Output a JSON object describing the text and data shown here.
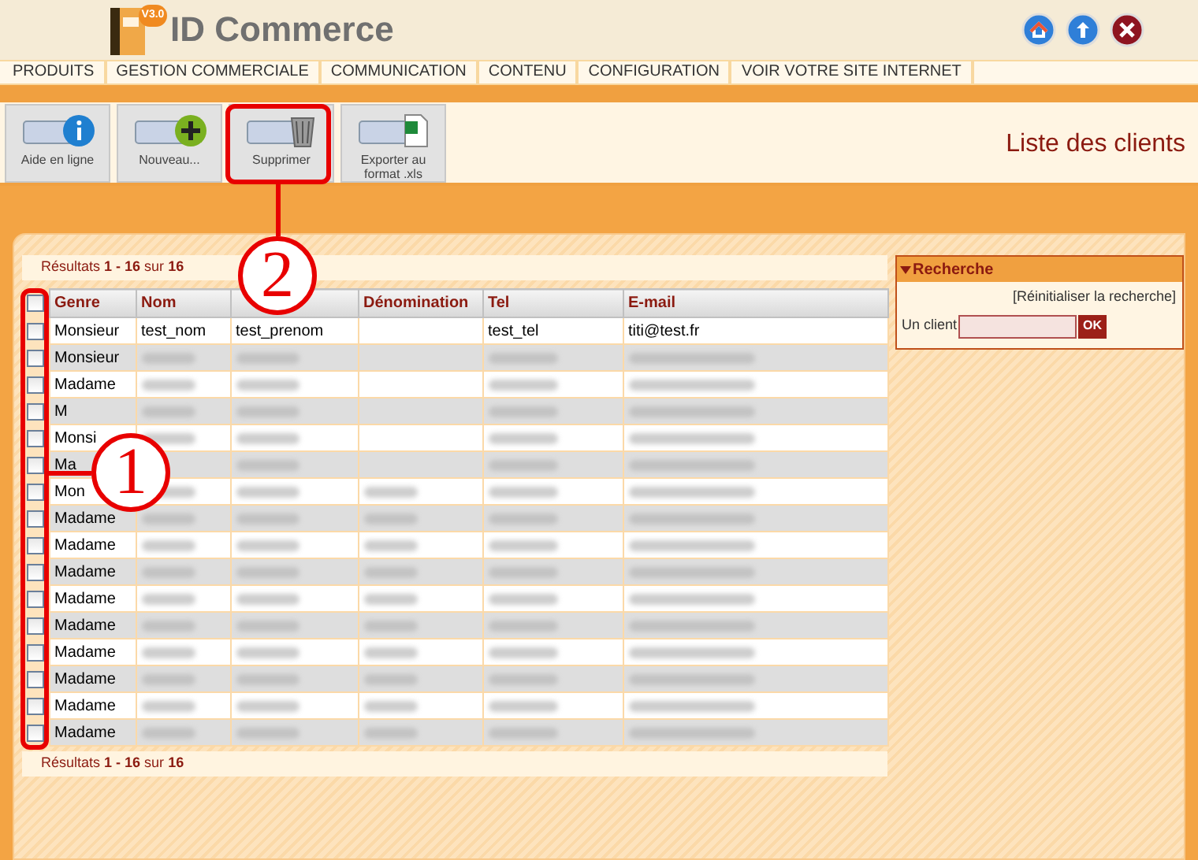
{
  "app": {
    "name": "ID Commerce",
    "version": "V3.0"
  },
  "menu": [
    {
      "label": "PRODUITS"
    },
    {
      "label": "GESTION COMMERCIALE"
    },
    {
      "label": "COMMUNICATION"
    },
    {
      "label": "CONTENU"
    },
    {
      "label": "CONFIGURATION"
    },
    {
      "label": "VOIR VOTRE SITE INTERNET"
    }
  ],
  "toolbar": [
    {
      "label": "Aide en ligne",
      "kind": "info"
    },
    {
      "label": "Nouveau...",
      "kind": "add"
    },
    {
      "label": "Supprimer",
      "kind": "delete"
    },
    {
      "label": "Exporter au format .xls",
      "kind": "excel"
    }
  ],
  "page_title": "Liste des clients",
  "results_top": {
    "prefix": "Résultats",
    "range": "1 - 16",
    "word": "sur",
    "total": "16"
  },
  "table": {
    "select_all": {
      "checked": false
    },
    "columns": [
      "Genre",
      "Nom",
      null,
      "Dénomination",
      "Tel",
      "E-mail"
    ],
    "rows": [
      {
        "checked": false,
        "cells": [
          {
            "kind": "text",
            "text": "Monsieur"
          },
          {
            "kind": "text",
            "text": "test_nom"
          },
          {
            "kind": "text",
            "text": "test_prenom"
          },
          {
            "kind": "empty"
          },
          {
            "kind": "text",
            "text": "test_tel"
          },
          {
            "kind": "text",
            "text": "titi@test.fr"
          }
        ]
      },
      {
        "checked": false,
        "cells": [
          {
            "kind": "text",
            "text": "Monsieur"
          },
          {
            "kind": "blurred"
          },
          {
            "kind": "blurred"
          },
          {
            "kind": "empty"
          },
          {
            "kind": "blurred"
          },
          {
            "kind": "blurred"
          }
        ]
      },
      {
        "checked": false,
        "cells": [
          {
            "kind": "text",
            "text": "Madame"
          },
          {
            "kind": "blurred"
          },
          {
            "kind": "blurred"
          },
          {
            "kind": "empty"
          },
          {
            "kind": "blurred"
          },
          {
            "kind": "blurred"
          }
        ]
      },
      {
        "checked": false,
        "cells": [
          {
            "kind": "text",
            "text": "M"
          },
          {
            "kind": "blurred"
          },
          {
            "kind": "blurred"
          },
          {
            "kind": "empty"
          },
          {
            "kind": "blurred"
          },
          {
            "kind": "blurred"
          }
        ]
      },
      {
        "checked": false,
        "cells": [
          {
            "kind": "text",
            "text": "Monsi"
          },
          {
            "kind": "blurred"
          },
          {
            "kind": "blurred"
          },
          {
            "kind": "empty"
          },
          {
            "kind": "blurred"
          },
          {
            "kind": "blurred"
          }
        ]
      },
      {
        "checked": false,
        "cells": [
          {
            "kind": "text",
            "text": "Ma"
          },
          {
            "kind": "empty"
          },
          {
            "kind": "blurred"
          },
          {
            "kind": "empty"
          },
          {
            "kind": "blurred"
          },
          {
            "kind": "blurred"
          }
        ]
      },
      {
        "checked": false,
        "cells": [
          {
            "kind": "text",
            "text": "Mon"
          },
          {
            "kind": "blurred"
          },
          {
            "kind": "blurred"
          },
          {
            "kind": "blurred"
          },
          {
            "kind": "blurred"
          },
          {
            "kind": "blurred"
          }
        ]
      },
      {
        "checked": false,
        "cells": [
          {
            "kind": "text",
            "text": "Madame"
          },
          {
            "kind": "blurred"
          },
          {
            "kind": "blurred"
          },
          {
            "kind": "blurred"
          },
          {
            "kind": "blurred"
          },
          {
            "kind": "blurred"
          }
        ]
      },
      {
        "checked": false,
        "cells": [
          {
            "kind": "text",
            "text": "Madame"
          },
          {
            "kind": "blurred"
          },
          {
            "kind": "blurred"
          },
          {
            "kind": "blurred"
          },
          {
            "kind": "blurred"
          },
          {
            "kind": "blurred"
          }
        ]
      },
      {
        "checked": false,
        "cells": [
          {
            "kind": "text",
            "text": "Madame"
          },
          {
            "kind": "blurred"
          },
          {
            "kind": "blurred"
          },
          {
            "kind": "blurred"
          },
          {
            "kind": "blurred"
          },
          {
            "kind": "blurred"
          }
        ]
      },
      {
        "checked": false,
        "cells": [
          {
            "kind": "text",
            "text": "Madame"
          },
          {
            "kind": "blurred"
          },
          {
            "kind": "blurred"
          },
          {
            "kind": "blurred"
          },
          {
            "kind": "blurred"
          },
          {
            "kind": "blurred"
          }
        ]
      },
      {
        "checked": false,
        "cells": [
          {
            "kind": "text",
            "text": "Madame"
          },
          {
            "kind": "blurred"
          },
          {
            "kind": "blurred"
          },
          {
            "kind": "blurred"
          },
          {
            "kind": "blurred"
          },
          {
            "kind": "blurred"
          }
        ]
      },
      {
        "checked": false,
        "cells": [
          {
            "kind": "text",
            "text": "Madame"
          },
          {
            "kind": "blurred"
          },
          {
            "kind": "blurred"
          },
          {
            "kind": "blurred"
          },
          {
            "kind": "blurred"
          },
          {
            "kind": "blurred"
          }
        ]
      },
      {
        "checked": false,
        "cells": [
          {
            "kind": "text",
            "text": "Madame"
          },
          {
            "kind": "blurred"
          },
          {
            "kind": "blurred"
          },
          {
            "kind": "blurred"
          },
          {
            "kind": "blurred"
          },
          {
            "kind": "blurred"
          }
        ]
      },
      {
        "checked": false,
        "cells": [
          {
            "kind": "text",
            "text": "Madame"
          },
          {
            "kind": "blurred"
          },
          {
            "kind": "blurred"
          },
          {
            "kind": "blurred"
          },
          {
            "kind": "blurred"
          },
          {
            "kind": "blurred"
          }
        ]
      },
      {
        "checked": false,
        "cells": [
          {
            "kind": "text",
            "text": "Madame"
          },
          {
            "kind": "blurred"
          },
          {
            "kind": "blurred"
          },
          {
            "kind": "blurred"
          },
          {
            "kind": "blurred"
          },
          {
            "kind": "blurred"
          }
        ]
      }
    ]
  },
  "results_bottom": {
    "prefix": "Résultats",
    "range": "1 - 16",
    "word": "sur",
    "total": "16"
  },
  "search": {
    "title": "Recherche",
    "reset": "[Réinitialiser la recherche]",
    "label": "Un client",
    "button": "OK"
  },
  "annotations": [
    {
      "label": "1"
    },
    {
      "label": "2"
    }
  ]
}
